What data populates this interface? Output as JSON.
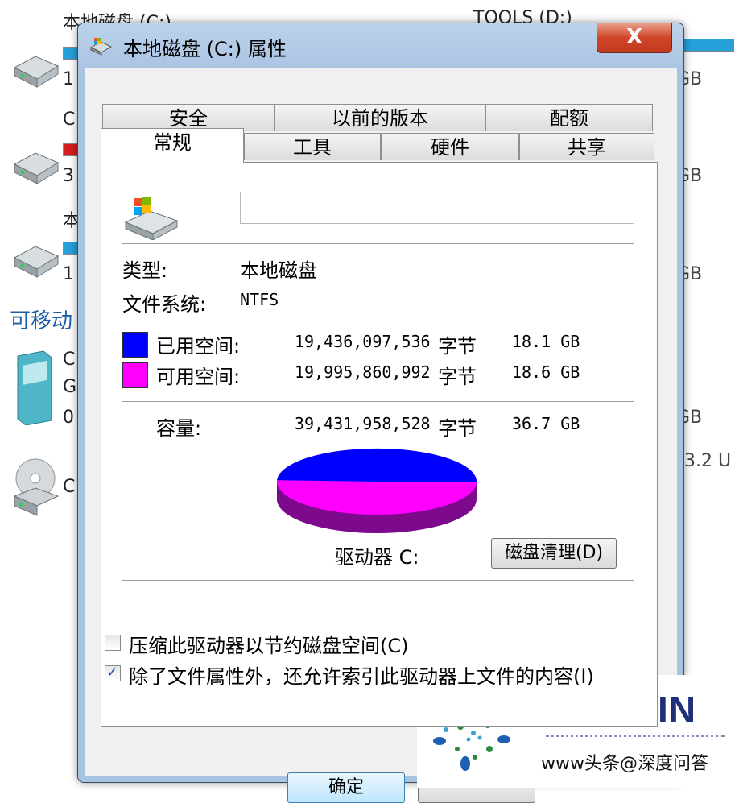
{
  "background": {
    "drives": [
      {
        "label": "本地磁盘 (C:)",
        "size_prefix": "1"
      },
      {
        "label": "C",
        "size_prefix": "3"
      },
      {
        "label": "本",
        "size_prefix": "1"
      }
    ],
    "right_sizes": [
      "GB",
      "GB",
      "GB"
    ],
    "removable_label": "可移动",
    "removable_items": [
      "C",
      "G",
      "0"
    ],
    "removable_right": "GB",
    "dvd_label": "C",
    "dvd_right": "3.2 U",
    "tools_label": "TOOLS (D:)"
  },
  "window": {
    "title": "本地磁盘 (C:) 属性",
    "close_label": "X"
  },
  "tabs": {
    "row1": [
      "安全",
      "以前的版本",
      "配额"
    ],
    "row2": [
      "常规",
      "工具",
      "硬件",
      "共享"
    ]
  },
  "general": {
    "name_value": "",
    "type_label": "类型:",
    "type_value": "本地磁盘",
    "fs_label": "文件系统:",
    "fs_value": "NTFS",
    "used_label": "已用空间:",
    "used_bytes": "19,436,097,536",
    "free_label": "可用空间:",
    "free_bytes": "19,995,860,992",
    "capacity_label": "容量:",
    "capacity_bytes": "39,431,958,528",
    "bytes_unit": "字节",
    "used_gb": "18.1 GB",
    "free_gb": "18.6 GB",
    "capacity_gb": "36.7 GB",
    "drive_label": "驱动器 C:",
    "cleanup_button": "磁盘清理(D)",
    "compress_label": "压缩此驱动器以节约磁盘空间(C)",
    "compress_checked": false,
    "index_label": "除了文件属性外，还允许索引此驱动器上文件的内容(I)",
    "index_checked": true
  },
  "usage": {
    "used_fraction": 0.493,
    "free_fraction": 0.507
  },
  "colors": {
    "used": "#0000ff",
    "free": "#ff00ff",
    "arrow": "#e0211e"
  },
  "buttons": {
    "ok": "确定"
  },
  "watermark": {
    "brand": "IDEEPIN",
    "url": "www头条@深度问答"
  }
}
